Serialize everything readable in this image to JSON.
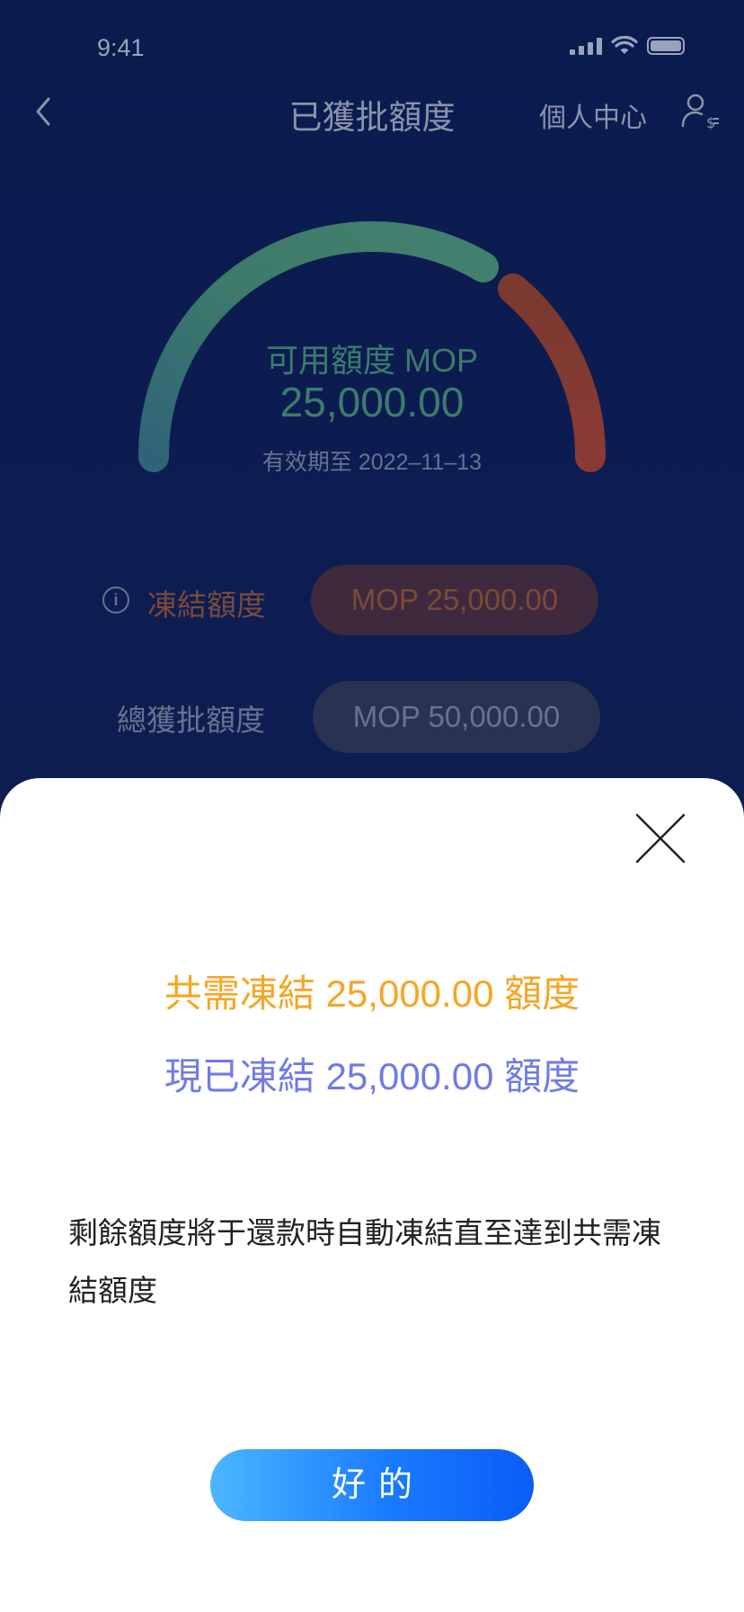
{
  "status_bar": {
    "time": "9:41"
  },
  "nav": {
    "title": "已獲批額度",
    "profile_label": "個人中心"
  },
  "gauge": {
    "label": "可用額度 MOP",
    "amount": "25,000.00",
    "expiry": "有效期至 2022–11–13",
    "colors": {
      "available": "#3c7c6c",
      "frozen": "#7c3a30"
    }
  },
  "frozen": {
    "label": "凍結額度",
    "value": "MOP 25,000.00"
  },
  "total": {
    "label": "總獲批額度",
    "value": "MOP 50,000.00"
  },
  "sheet": {
    "required_line": "共需凍結 25,000.00 額度",
    "frozen_line": "現已凍結 25,000.00 額度",
    "description": "剩餘額度將于還款時自動凍結直至達到共需凍結額度",
    "ok_label": "好的",
    "colors": {
      "required": "#f5a623",
      "frozen": "#6f7be6",
      "button": "#1a7bff"
    }
  },
  "icons": {
    "back": "chevron-left-icon",
    "profile": "user-dollar-icon",
    "info": "info-icon",
    "close": "close-icon"
  }
}
